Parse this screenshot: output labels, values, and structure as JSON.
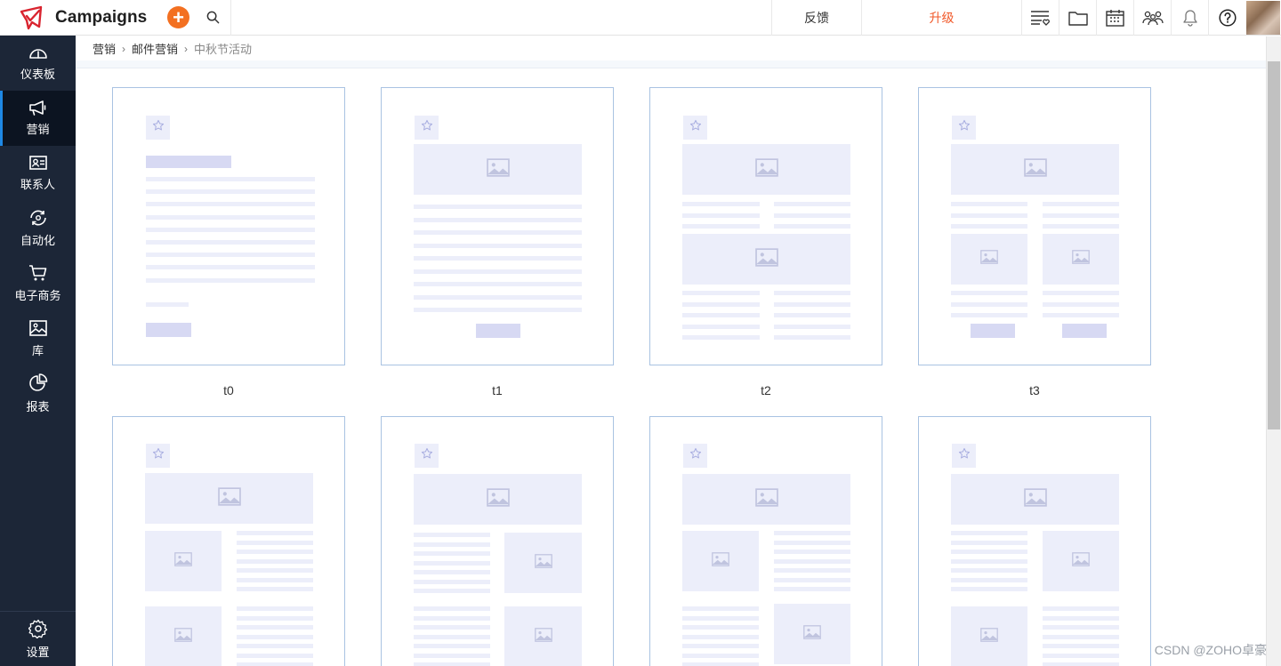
{
  "app": {
    "name": "Campaigns",
    "brand_color": "#d9242f",
    "accent_color": "#f37021"
  },
  "topbar": {
    "new_label": "+",
    "feedback_label": "反馈",
    "upgrade_label": "升级",
    "icons": [
      "list-heart-icon",
      "folder-icon",
      "calendar-icon",
      "users-icon",
      "bell-icon",
      "help-icon"
    ]
  },
  "sidebar": {
    "items": [
      {
        "label": "仪表板",
        "icon": "dashboard-gauge-icon"
      },
      {
        "label": "营销",
        "icon": "megaphone-icon",
        "active": true
      },
      {
        "label": "联系人",
        "icon": "contact-card-icon"
      },
      {
        "label": "自动化",
        "icon": "automation-icon"
      },
      {
        "label": "电子商务",
        "icon": "cart-icon"
      },
      {
        "label": "库",
        "icon": "image-library-icon"
      },
      {
        "label": "报表",
        "icon": "pie-chart-icon"
      }
    ],
    "settings_label": "设置"
  },
  "breadcrumb": {
    "items": [
      "营销",
      "邮件营销"
    ],
    "current": "中秋节活动"
  },
  "templates": [
    {
      "name": "t0"
    },
    {
      "name": "t1"
    },
    {
      "name": "t2"
    },
    {
      "name": "t3"
    },
    {
      "name": ""
    },
    {
      "name": ""
    },
    {
      "name": ""
    },
    {
      "name": ""
    }
  ],
  "watermark": "CSDN @ZOHO卓豪"
}
